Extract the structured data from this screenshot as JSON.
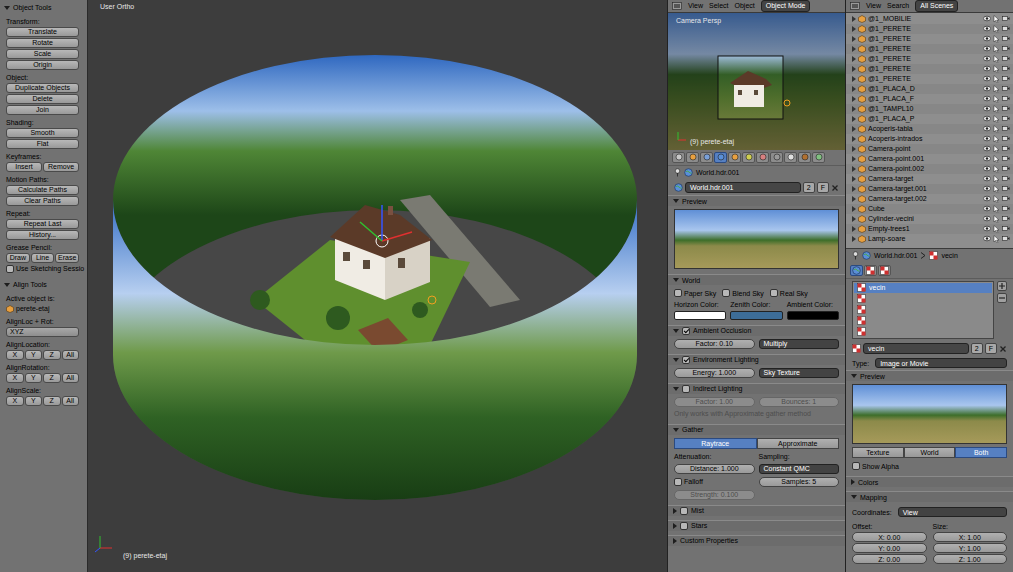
{
  "toolbar": {
    "panels": [
      {
        "title": "Object Tools",
        "expanded": true,
        "rows": [
          {
            "kind": "label",
            "text": "Transform:"
          },
          {
            "kind": "buttons",
            "buttons": [
              "Translate"
            ]
          },
          {
            "kind": "buttons",
            "buttons": [
              "Rotate"
            ]
          },
          {
            "kind": "buttons",
            "buttons": [
              "Scale"
            ]
          },
          {
            "kind": "buttons",
            "buttons": [
              "Origin"
            ]
          },
          {
            "kind": "label",
            "text": "Object:"
          },
          {
            "kind": "buttons",
            "buttons": [
              "Duplicate Objects"
            ]
          },
          {
            "kind": "buttons",
            "buttons": [
              "Delete"
            ]
          },
          {
            "kind": "buttons",
            "buttons": [
              "Join"
            ]
          },
          {
            "kind": "label",
            "text": "Shading:"
          },
          {
            "kind": "buttons",
            "buttons": [
              "Smooth"
            ]
          },
          {
            "kind": "buttons",
            "buttons": [
              "Flat"
            ]
          },
          {
            "kind": "label",
            "text": "Keyframes:"
          },
          {
            "kind": "buttons",
            "buttons": [
              "Insert",
              "Remove"
            ]
          },
          {
            "kind": "label",
            "text": "Motion Paths:"
          },
          {
            "kind": "buttons",
            "buttons": [
              "Calculate Paths"
            ]
          },
          {
            "kind": "buttons",
            "buttons": [
              "Clear Paths"
            ]
          },
          {
            "kind": "label",
            "text": "Repeat:"
          },
          {
            "kind": "buttons",
            "buttons": [
              "Repeat Last"
            ]
          },
          {
            "kind": "buttons",
            "buttons": [
              "History..."
            ]
          },
          {
            "kind": "label",
            "text": "Grease Pencil:"
          },
          {
            "kind": "buttons",
            "buttons": [
              "Draw",
              "Line",
              "Erase"
            ]
          },
          {
            "kind": "checkbox",
            "text": "Use Sketching Sessio",
            "checked": false
          }
        ]
      },
      {
        "title": "Align Tools",
        "expanded": true,
        "rows": [
          {
            "kind": "label",
            "text": "Active object is:"
          },
          {
            "kind": "field",
            "text": "perete-etaj"
          },
          {
            "kind": "label",
            "text": "AlignLoc + Rot:"
          },
          {
            "kind": "dropdown",
            "text": "XYZ"
          },
          {
            "kind": "label",
            "text": "AlignLocation:"
          },
          {
            "kind": "buttons",
            "buttons": [
              "X",
              "Y",
              "Z",
              "All"
            ]
          },
          {
            "kind": "label",
            "text": "AlignRotation:"
          },
          {
            "kind": "buttons",
            "buttons": [
              "X",
              "Y",
              "Z",
              "All"
            ]
          },
          {
            "kind": "label",
            "text": "AlignScale:"
          },
          {
            "kind": "buttons",
            "buttons": [
              "X",
              "Y",
              "Z",
              "All"
            ]
          }
        ]
      }
    ]
  },
  "viewport": {
    "view_name": "User Ortho",
    "object_info": "(9) perete-etaj"
  },
  "camera_header": {
    "menus": [
      "View",
      "Select",
      "Object"
    ],
    "mode": "Object Mode"
  },
  "camera_view": {
    "view_name": "Camera Persp",
    "object_info": "(9) perete-etaj"
  },
  "properties": {
    "tabs": [
      {
        "selected": false
      },
      {
        "selected": false
      },
      {
        "selected": false
      },
      {
        "selected": true
      },
      {
        "selected": false
      },
      {
        "selected": false
      },
      {
        "selected": false
      },
      {
        "selected": false
      },
      {
        "selected": false
      },
      {
        "selected": false
      },
      {
        "selected": false
      }
    ],
    "breadcrumb": "World.hdr.001",
    "datablock": {
      "name": "World.hdr.001",
      "users": "2",
      "fake": "F"
    },
    "panels": [
      {
        "title": "Preview",
        "expanded": true,
        "rows": [
          {
            "kind": "preview"
          }
        ]
      },
      {
        "title": "World",
        "expanded": true,
        "rows": [
          {
            "kind": "checks",
            "items": [
              {
                "label": "Paper Sky",
                "checked": false
              },
              {
                "label": "Blend Sky",
                "checked": false
              },
              {
                "label": "Real Sky",
                "checked": false
              }
            ]
          },
          {
            "kind": "colors",
            "items": [
              {
                "label": "Horizon Color:",
                "color": "#ffffff"
              },
              {
                "label": "Zenith Color:",
                "color": "#3d6d98"
              },
              {
                "label": "Ambient Color:",
                "color": "#000000"
              }
            ]
          }
        ]
      },
      {
        "title": "Ambient Occlusion",
        "expanded": true,
        "checked": true,
        "rows": [
          {
            "kind": "fields",
            "items": [
              {
                "text": "Factor: 0.10",
                "kind": "number",
                "disabled": false
              },
              {
                "text": "Multiply",
                "kind": "menu",
                "disabled": false
              }
            ]
          }
        ]
      },
      {
        "title": "Environment Lighting",
        "expanded": true,
        "checked": true,
        "rows": [
          {
            "kind": "fields",
            "items": [
              {
                "text": "Energy: 1.000",
                "kind": "number",
                "disabled": false
              },
              {
                "text": "Sky Texture",
                "kind": "menu",
                "disabled": false
              }
            ]
          }
        ]
      },
      {
        "title": "Indirect Lighting",
        "expanded": true,
        "checked": false,
        "rows": [
          {
            "kind": "fields",
            "items": [
              {
                "text": "Factor: 1.00",
                "kind": "number",
                "disabled": true
              },
              {
                "text": "Bounces: 1",
                "kind": "number",
                "disabled": true
              }
            ]
          },
          {
            "kind": "note",
            "text": "Only works with Approximate gather method"
          }
        ]
      },
      {
        "title": "Gather",
        "expanded": true,
        "rows": [
          {
            "kind": "toggles",
            "items": [
              {
                "label": "Raytrace",
                "selected": true
              },
              {
                "label": "Approximate",
                "selected": false
              }
            ]
          },
          {
            "kind": "fields",
            "items": [
              {
                "text": "Attenuation:",
                "kind": "label",
                "disabled": false
              },
              {
                "text": "Sampling:",
                "kind": "label",
                "disabled": false
              }
            ]
          },
          {
            "kind": "fields",
            "items": [
              {
                "text": "Distance: 1.000",
                "kind": "number",
                "disabled": false
              },
              {
                "text": "Constant QMC",
                "kind": "menu",
                "disabled": false
              }
            ]
          },
          {
            "kind": "fields",
            "items": [
              {
                "text": "Falloff",
                "kind": "checkbox",
                "checked": false,
                "disabled": false
              },
              {
                "text": "Samples: 5",
                "kind": "number",
                "disabled": false
              }
            ]
          },
          {
            "kind": "fields",
            "items": [
              {
                "text": "Strength: 0.100",
                "kind": "number",
                "disabled": true
              }
            ]
          }
        ]
      },
      {
        "title": "Mist",
        "expanded": false,
        "checked": false,
        "rows": []
      },
      {
        "title": "Stars",
        "expanded": false,
        "checked": false,
        "rows": []
      },
      {
        "title": "Custom Properties",
        "expanded": false,
        "rows": []
      }
    ]
  },
  "outliner": {
    "menus": [
      "View",
      "Search"
    ],
    "scope": "All Scenes",
    "items": [
      {
        "name": "@1_MOBILIE"
      },
      {
        "name": "@1_PERETE"
      },
      {
        "name": "@1_PERETE"
      },
      {
        "name": "@1_PERETE"
      },
      {
        "name": "@1_PERETE"
      },
      {
        "name": "@1_PERETE"
      },
      {
        "name": "@1_PERETE"
      },
      {
        "name": "@1_PLACA_D"
      },
      {
        "name": "@1_PLACA_F"
      },
      {
        "name": "@1_TAMPL10"
      },
      {
        "name": "@1_PLACA_P"
      },
      {
        "name": "Acoperis-tabla"
      },
      {
        "name": "Acoperis-intrados"
      },
      {
        "name": "Camera-point"
      },
      {
        "name": "Camera-point.001"
      },
      {
        "name": "Camera-point.002"
      },
      {
        "name": "Camera-target"
      },
      {
        "name": "Camera-target.001"
      },
      {
        "name": "Camera-target.002"
      },
      {
        "name": "Cube"
      },
      {
        "name": "Cylinder-vecini"
      },
      {
        "name": "Empty-trees1"
      },
      {
        "name": "Lamp-soare"
      }
    ]
  },
  "texture": {
    "breadcrumb": [
      "World.hdr.001",
      "vecin"
    ],
    "tabs": [
      {
        "selected": true
      },
      {
        "selected": false
      },
      {
        "selected": false
      }
    ],
    "slots": [
      {
        "name": "vecin",
        "selected": true
      },
      {
        "selected": false
      },
      {
        "selected": false
      },
      {
        "selected": false
      },
      {
        "selected": false
      }
    ],
    "datablock": {
      "name": "vecin",
      "users": "2",
      "fake": "F"
    },
    "type_label": "Type:",
    "type": "Image or Movie",
    "preview": {
      "title": "Preview",
      "expanded": true,
      "toggles": [
        {
          "label": "Texture",
          "selected": false
        },
        {
          "label": "World",
          "selected": false
        },
        {
          "label": "Both",
          "selected": true
        }
      ],
      "show_alpha": {
        "label": "Show Alpha",
        "checked": false
      }
    },
    "colors": {
      "title": "Colors",
      "expanded": false
    },
    "mapping": {
      "title": "Mapping",
      "expanded": true,
      "coordinates_label": "Coordinates:",
      "coordinates": "View",
      "offset_label": "Offset:",
      "offset": [
        "X: 0.00",
        "Y: 0.00",
        "Z: 0.00"
      ],
      "size_label": "Size:",
      "size": [
        "X: 1.00",
        "Y: 1.00",
        "Z: 1.00"
      ]
    }
  }
}
